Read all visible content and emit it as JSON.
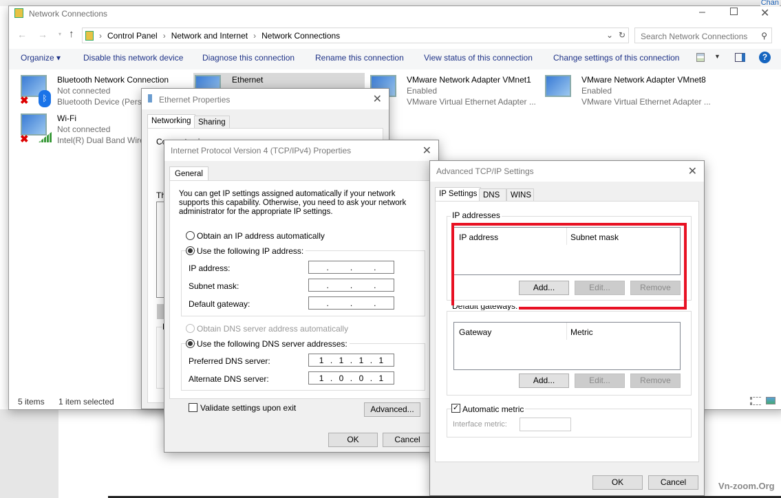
{
  "explorer": {
    "title": "Network Connections",
    "breadcrumb": [
      "Control Panel",
      "Network and Internet",
      "Network Connections"
    ],
    "search_placeholder": "Search Network Connections",
    "commands": {
      "organize": "Organize",
      "disable": "Disable this network device",
      "diagnose": "Diagnose this connection",
      "rename": "Rename this connection",
      "view_status": "View status of this connection",
      "change_settings": "Change settings of this connection"
    },
    "connections": [
      {
        "name": "Bluetooth Network Connection",
        "status": "Not connected",
        "device": "Bluetooth Device (Perso",
        "icon": "bluetooth-icon"
      },
      {
        "name": "Ethernet",
        "status": "",
        "device": "",
        "icon": "ethernet-icon"
      },
      {
        "name": "VMware Network Adapter VMnet1",
        "status": "Enabled",
        "device": "VMware Virtual Ethernet Adapter ...",
        "icon": "network-adapter-icon"
      },
      {
        "name": "VMware Network Adapter VMnet8",
        "status": "Enabled",
        "device": "VMware Virtual Ethernet Adapter ...",
        "icon": "network-adapter-icon"
      },
      {
        "name": "Wi-Fi",
        "status": "Not connected",
        "device": "Intel(R) Dual Band Wire",
        "icon": "wifi-signal-icon"
      }
    ],
    "status": {
      "items": "5 items",
      "selected": "1 item selected"
    },
    "top_right_text": "Chan"
  },
  "ethernet_props": {
    "title": "Ethernet Properties",
    "tabs": [
      "Networking",
      "Sharing"
    ],
    "connect_using": "Connect using:",
    "this_conn": "Th",
    "desc": "D"
  },
  "ipv4": {
    "title": "Internet Protocol Version 4 (TCP/IPv4) Properties",
    "tab": "General",
    "intro": "You can get IP settings assigned automatically if your network supports this capability. Otherwise, you need to ask your network administrator for the appropriate IP settings.",
    "auto_ip": "Obtain an IP address automatically",
    "use_ip": "Use the following IP address:",
    "ip_label": "IP address:",
    "mask_label": "Subnet mask:",
    "gw_label": "Default gateway:",
    "auto_dns": "Obtain DNS server address automatically",
    "use_dns": "Use the following DNS server addresses:",
    "pref_label": "Preferred DNS server:",
    "alt_label": "Alternate DNS server:",
    "pref_dns": [
      "1",
      "1",
      "1",
      "1"
    ],
    "alt_dns": [
      "1",
      "0",
      "0",
      "1"
    ],
    "validate": "Validate settings upon exit",
    "advanced": "Advanced...",
    "ok": "OK",
    "cancel": "Cancel"
  },
  "advanced": {
    "title": "Advanced TCP/IP Settings",
    "tabs": [
      "IP Settings",
      "DNS",
      "WINS"
    ],
    "ip_group": "IP addresses",
    "ip_col": "IP address",
    "mask_col": "Subnet mask",
    "gw_group": "Default gateways:",
    "gw_col": "Gateway",
    "metric_col": "Metric",
    "add": "Add...",
    "edit": "Edit...",
    "remove": "Remove",
    "auto_metric": "Automatic metric",
    "iface_metric": "Interface metric:",
    "ok": "OK",
    "cancel": "Cancel",
    "highlight_color": "#e81123"
  },
  "watermark": "Vn-zoom.Org"
}
